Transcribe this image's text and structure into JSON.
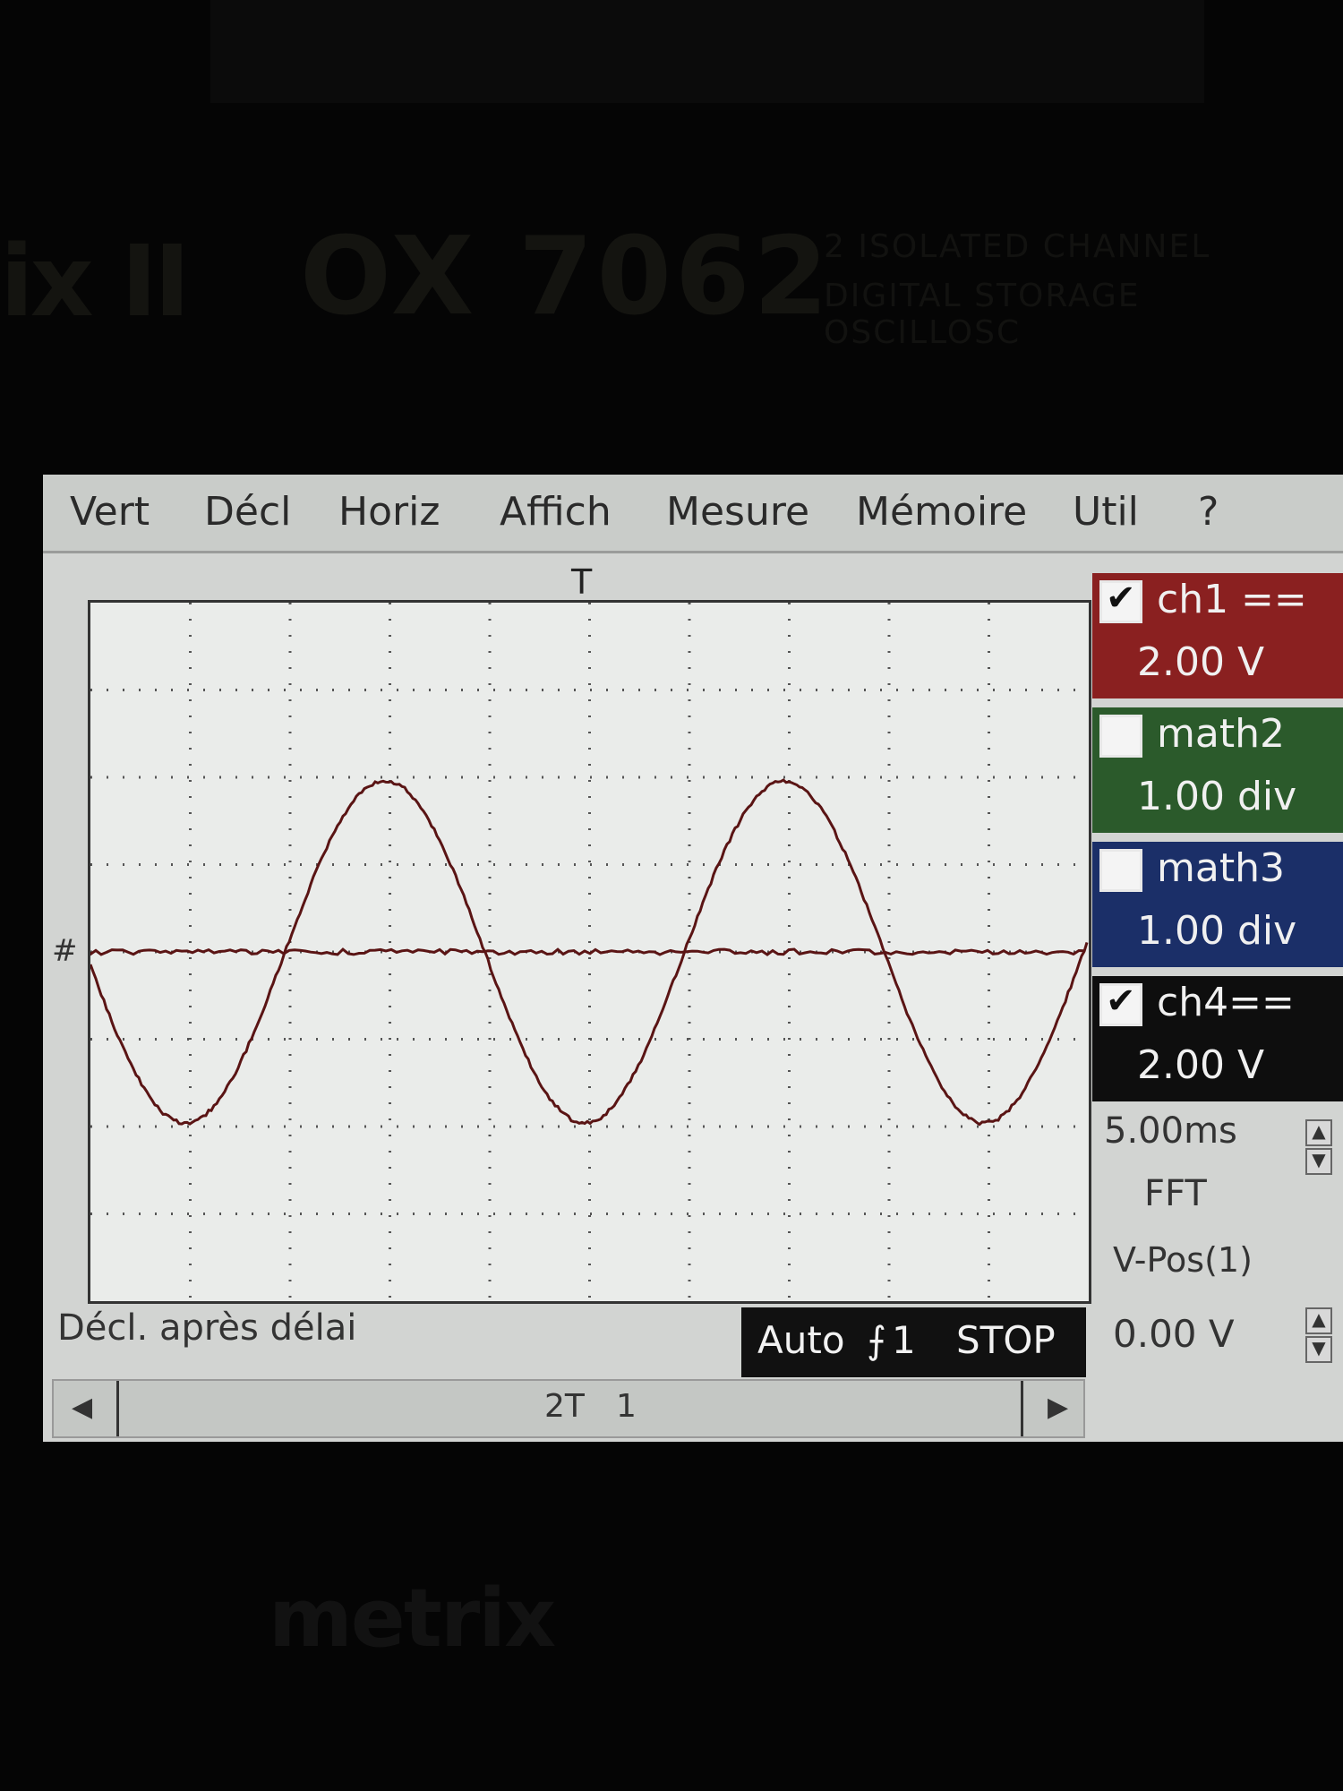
{
  "bezel": {
    "series": "ix II",
    "model": "OX 7062",
    "description_line1": "2 ISOLATED CHANNEL",
    "description_line2": "DIGITAL STORAGE OSCILLOSC",
    "brand_logo": "metrix"
  },
  "menu": [
    "Vert",
    "Décl",
    "Horiz",
    "Affich",
    "Mesure",
    "Mémoire",
    "Util",
    "?"
  ],
  "markers": {
    "trigger": "T",
    "ground": "#"
  },
  "channels": [
    {
      "name": "ch1 ==",
      "scale": "2.00 V",
      "checked": true,
      "color": "#8a2020"
    },
    {
      "name": "math2",
      "scale": "1.00 div",
      "checked": false,
      "color": "#2b5a2b"
    },
    {
      "name": "math3",
      "scale": "1.00 div",
      "checked": false,
      "color": "#1b2f68"
    },
    {
      "name": "ch4==",
      "scale": "2.00 V",
      "checked": true,
      "color": "#0e0e0e"
    }
  ],
  "timebase": "5.00ms",
  "fft_label": "FFT",
  "vpos": {
    "title": "V-Pos(1)",
    "value": "0.00 V"
  },
  "status": {
    "trigger_mode_text": "Décl. après délai",
    "acq_mode": "Auto",
    "trigger_source": "1",
    "run_state": "STOP"
  },
  "scroll_markers": {
    "left": "2T",
    "right": "1"
  },
  "trace_color": "#5a1414",
  "display_color": "#eaecea"
}
